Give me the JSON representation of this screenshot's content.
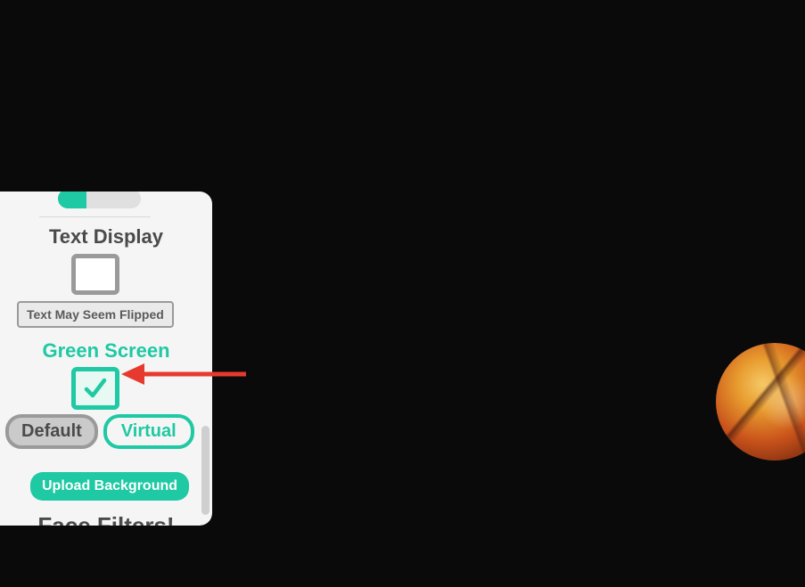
{
  "sections": {
    "text_display": {
      "title": "Text Display",
      "hint": "Text May Seem Flipped"
    },
    "green_screen": {
      "title": "Green Screen"
    },
    "face_filters": {
      "title": "Face Filters!"
    }
  },
  "tabs": {
    "default": "Default",
    "virtual": "Virtual"
  },
  "actions": {
    "upload": "Upload Background"
  },
  "colors": {
    "accent": "#1ec9a3",
    "text_muted": "#4a4a4a"
  }
}
